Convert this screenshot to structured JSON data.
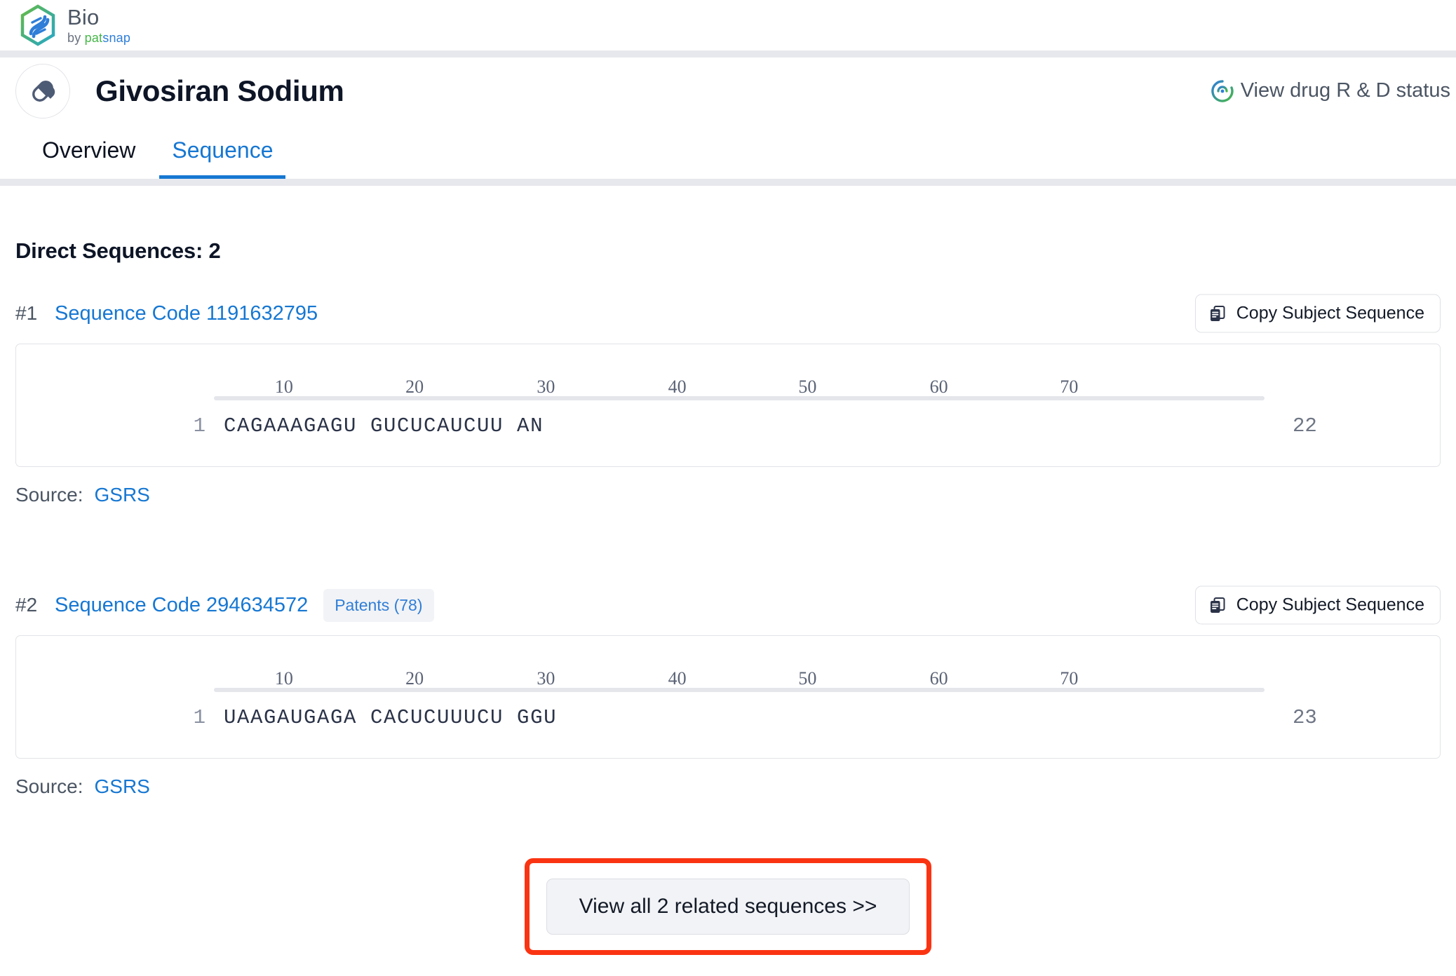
{
  "brand": {
    "name": "Bio",
    "by_prefix": "by ",
    "by_pat": "pat",
    "by_snap": "snap",
    "logo_icon": "dna-hexagon-logo-icon"
  },
  "header": {
    "drug_icon": "capsule-pill-icon",
    "title": "Givosiran Sodium",
    "rd_link_label": "View drug R & D status",
    "rd_link_icon": "patsnap-circle-icon"
  },
  "tabs": [
    {
      "label": "Overview",
      "active": false,
      "name": "tab-overview"
    },
    {
      "label": "Sequence",
      "active": true,
      "name": "tab-sequence"
    }
  ],
  "main": {
    "section_title": "Direct Sequences: 2",
    "ruler_ticks": [
      "10",
      "20",
      "30",
      "40",
      "50",
      "60",
      "70"
    ],
    "copy_button_label": "Copy Subject Sequence",
    "copy_button_icon": "copy-icon",
    "source_label": "Source:",
    "sequences": [
      {
        "index": "#1",
        "code_label": "Sequence Code 1191632795",
        "badge": null,
        "start": "1",
        "residues": "CAGAAAGAGU GUCUCAUCUU AN",
        "end": "22",
        "source": "GSRS"
      },
      {
        "index": "#2",
        "code_label": "Sequence Code 294634572",
        "badge": "Patents (78)",
        "start": "1",
        "residues": "UAAGAUGAGA CACUCUUUCU GGU",
        "end": "23",
        "source": "GSRS"
      }
    ],
    "view_all_label": "View all 2 related sequences >>"
  },
  "colors": {
    "accent_blue": "#1677d2",
    "annotation_red": "#fa3412",
    "title_dark": "#0d1526",
    "muted_gray": "#4b5563",
    "brand_green": "#46b749"
  }
}
